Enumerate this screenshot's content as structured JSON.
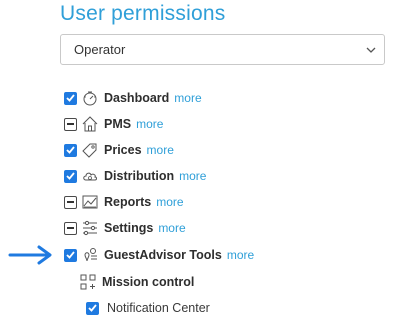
{
  "title": "User permissions",
  "role_select": {
    "value": "Operator"
  },
  "permissions": [
    {
      "label": "Dashboard",
      "more": "more",
      "state": "checked",
      "icon": "dashboard-icon"
    },
    {
      "label": "PMS",
      "more": "more",
      "state": "partial",
      "icon": "home-icon"
    },
    {
      "label": "Prices",
      "more": "more",
      "state": "checked",
      "icon": "tag-icon"
    },
    {
      "label": "Distribution",
      "more": "more",
      "state": "checked",
      "icon": "cloud-icon"
    },
    {
      "label": "Reports",
      "more": "more",
      "state": "partial",
      "icon": "chart-icon"
    },
    {
      "label": "Settings",
      "more": "more",
      "state": "partial",
      "icon": "sliders-icon"
    },
    {
      "label": "GuestAdvisor Tools",
      "more": "more",
      "state": "checked",
      "icon": "guest-advisor-icon",
      "highlighted": true
    },
    {
      "label": "Mission control",
      "icon": "grid-plus-icon"
    },
    {
      "label": "Notification Center",
      "state": "checked"
    }
  ],
  "colors": {
    "accent": "#2f9fd8",
    "checkbox": "#1f7ae0",
    "arrow": "#1f7ae0"
  }
}
